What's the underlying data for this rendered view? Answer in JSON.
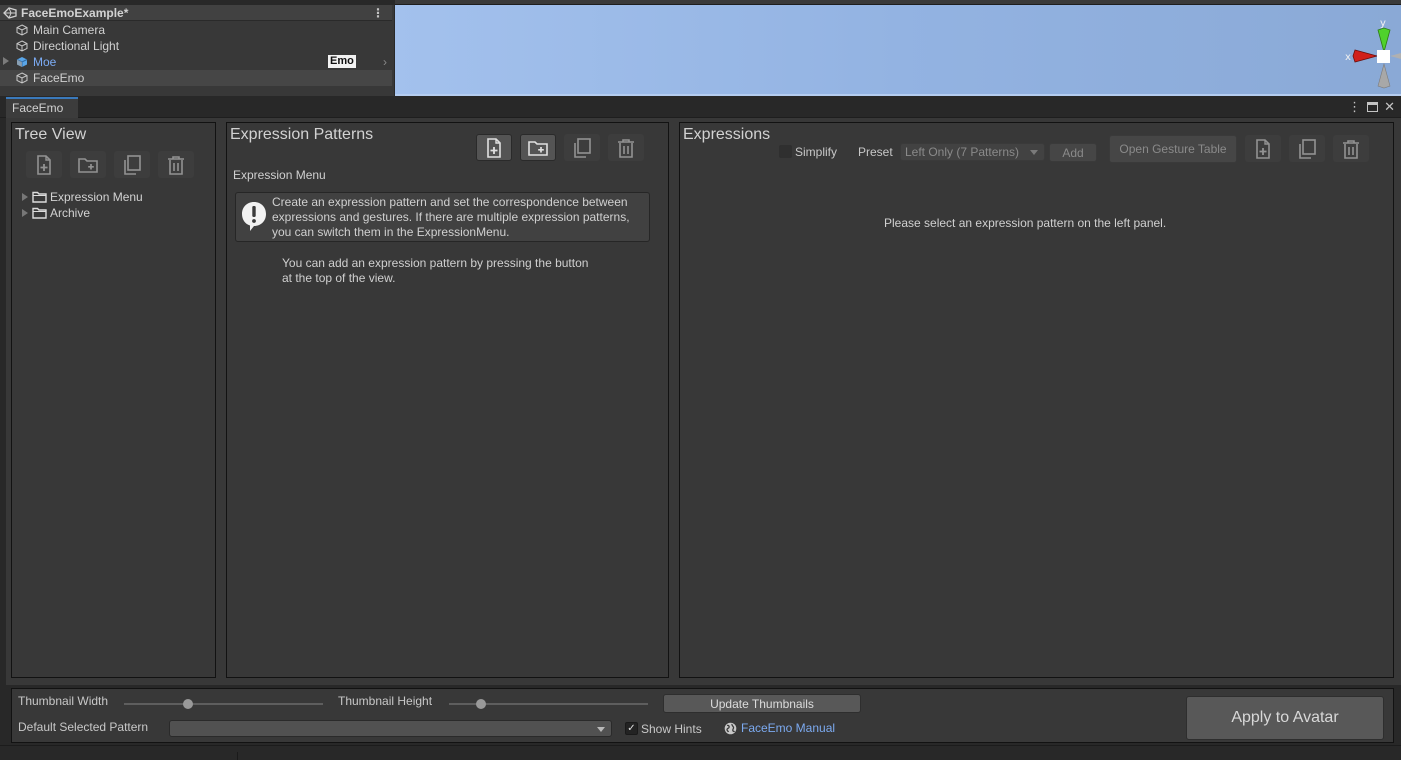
{
  "hierarchy": {
    "scene_name": "FaceEmoExample*",
    "items": [
      {
        "label": "Main Camera",
        "type": "gameobject"
      },
      {
        "label": "Directional Light",
        "type": "gameobject"
      },
      {
        "label": "Moe",
        "type": "prefab",
        "badge": "Emo"
      },
      {
        "label": "FaceEmo",
        "type": "gameobject",
        "selected": true
      }
    ]
  },
  "scene_view": {
    "gizmo": {
      "x_label": "x",
      "y_label": "y"
    }
  },
  "window": {
    "tab_label": "FaceEmo",
    "controls": {
      "menu": "⋮",
      "maximize": "□",
      "close": "✕"
    }
  },
  "tree_view": {
    "title": "Tree View",
    "toolbar": [
      "add-pattern-icon",
      "add-group-icon",
      "copy-icon",
      "delete-icon"
    ],
    "items": [
      {
        "label": "Expression Menu"
      },
      {
        "label": "Archive"
      }
    ]
  },
  "expression_patterns": {
    "title": "Expression Patterns",
    "toolbar": [
      "add-pattern-icon",
      "add-group-icon",
      "copy-icon",
      "delete-icon"
    ],
    "section_label": "Expression Menu",
    "hint_lines": [
      "Create an expression pattern and set the correspondence between",
      "expressions and gestures. If there are multiple expression patterns,",
      "you can switch them in the ExpressionMenu."
    ],
    "empty_lines": [
      "You can add an expression pattern by pressing the button",
      "at the top of the view."
    ]
  },
  "expressions": {
    "title": "Expressions",
    "simplify_label": "Simplify",
    "simplify_checked": false,
    "preset_label": "Preset",
    "preset_value": "Left Only (7 Patterns)",
    "add_label": "Add",
    "open_gesture_table_label": "Open Gesture Table",
    "toolbar": [
      "add-expression-icon",
      "copy-icon",
      "delete-icon"
    ],
    "empty_message": "Please select an expression pattern on the left panel."
  },
  "settings": {
    "thumbnail_width_label": "Thumbnail Width",
    "thumbnail_width_value": 0.32,
    "thumbnail_height_label": "Thumbnail Height",
    "thumbnail_height_value": 0.16,
    "update_thumbnails_label": "Update Thumbnails",
    "default_selected_pattern_label": "Default Selected Pattern",
    "default_selected_pattern_value": "",
    "show_hints_label": "Show Hints",
    "show_hints_checked": true,
    "manual_link_label": "FaceEmo Manual",
    "apply_label": "Apply to Avatar"
  },
  "colors": {
    "accent_tab": "#3a79bb",
    "link": "#7caaf0",
    "prefab_text": "#7cacf5",
    "panel_bg": "#383838"
  }
}
